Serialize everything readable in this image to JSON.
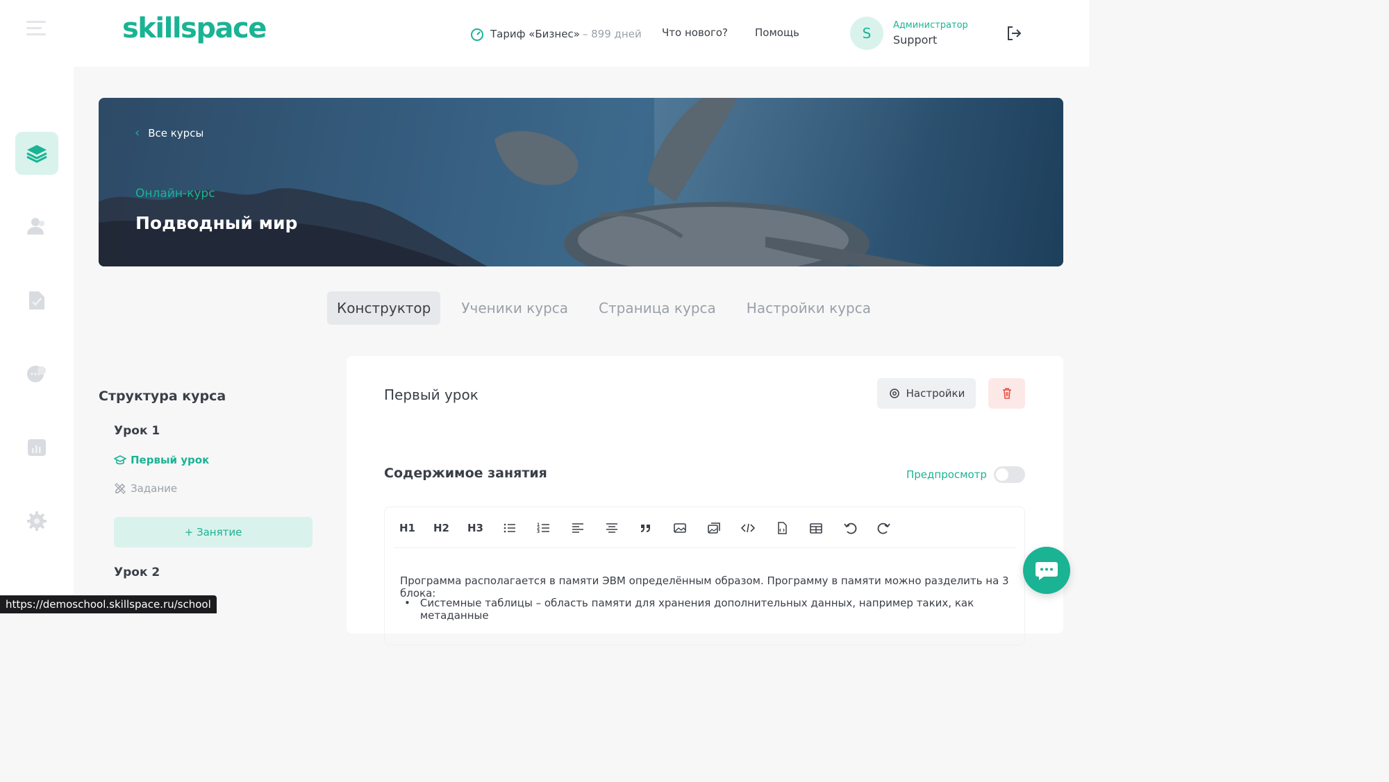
{
  "header": {
    "logo": "skillspace",
    "tariff_label": "Тариф «Бизнес»",
    "tariff_days": "– 899 дней",
    "nav": [
      "Что нового?",
      "Помощь"
    ],
    "avatar_letter": "S",
    "user_role": "Администратор",
    "user_name": "Support"
  },
  "sidebar": {
    "items": [
      {
        "name": "courses",
        "icon": "layers-icon",
        "active": true
      },
      {
        "name": "students",
        "icon": "users-icon",
        "active": false
      },
      {
        "name": "homework",
        "icon": "document-check-icon",
        "active": false
      },
      {
        "name": "messages",
        "icon": "chat-icon",
        "active": false
      },
      {
        "name": "analytics",
        "icon": "chart-icon",
        "active": false
      },
      {
        "name": "settings",
        "icon": "gear-icon",
        "active": false
      }
    ]
  },
  "banner": {
    "back_label": "Все курсы",
    "course_kind": "Онлайн-курс",
    "course_title": "Подводный мир"
  },
  "tabs": [
    {
      "label": "Конструктор",
      "active": true
    },
    {
      "label": "Ученики курса",
      "active": false
    },
    {
      "label": "Страница курса",
      "active": false
    },
    {
      "label": "Настройки курса",
      "active": false
    }
  ],
  "structure": {
    "title": "Структура курса",
    "lessons": [
      {
        "label": "Урок 1",
        "items": [
          {
            "label": "Первый урок",
            "icon": "graduation-cap-icon",
            "active": true
          },
          {
            "label": "Задание",
            "icon": "pencil-ruler-icon",
            "active": false
          }
        ]
      },
      {
        "label": "Урок 2",
        "items": []
      }
    ],
    "add_label": "+ Занятие"
  },
  "lesson": {
    "name": "Первый урок",
    "settings_label": "Настройки",
    "content_title": "Содержимое занятия",
    "preview_label": "Предпросмотр",
    "preview_enabled": false
  },
  "editor": {
    "toolbar": [
      "H1",
      "H2",
      "H3",
      "bulleted-list-icon",
      "numbered-list-icon",
      "align-left-icon",
      "align-center-icon",
      "quote-icon",
      "image-icon",
      "gallery-icon",
      "code-icon",
      "file-icon",
      "table-icon",
      "undo-icon",
      "redo-icon"
    ],
    "paragraph": "Программа располагается в памяти ЭВМ определённым образом. Программу в памяти можно разделить на 3 блока:",
    "bullet": "Системные таблицы – область памяти для хранения дополнительных данных, например таких, как метаданные"
  },
  "status_url": "https://demoschool.skillspace.ru/school",
  "colors": {
    "accent": "#1ab394",
    "danger": "#e74c3c",
    "background": "#f7f7f8"
  }
}
